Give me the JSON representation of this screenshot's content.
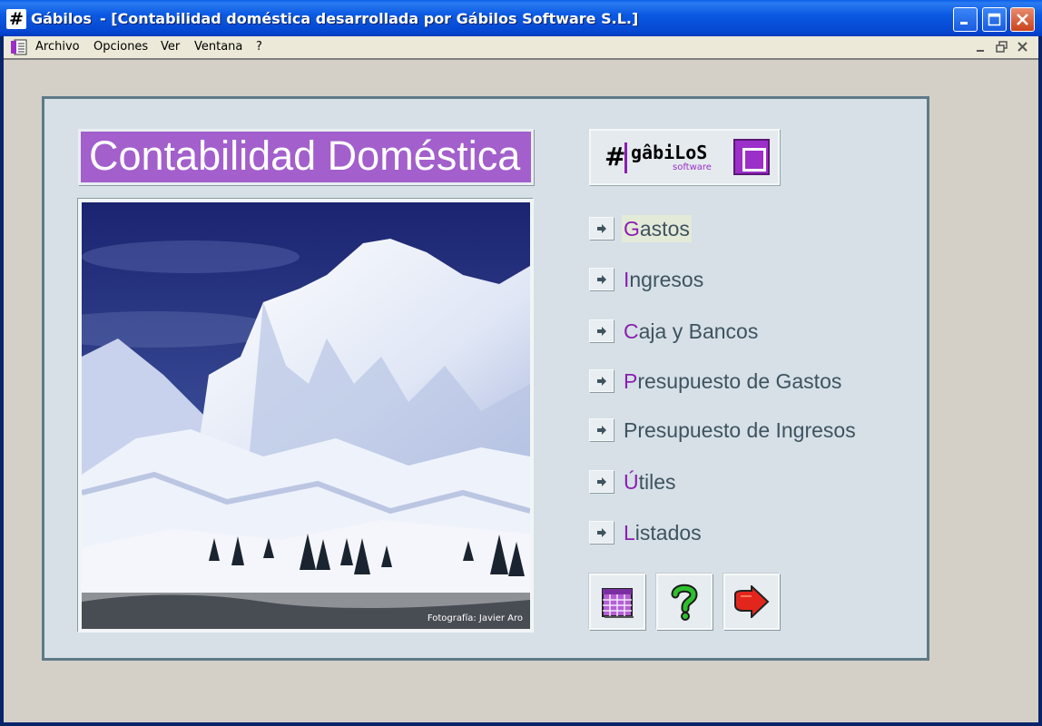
{
  "window": {
    "app_name": "Gábilos",
    "document_title": "- [Contabilidad doméstica desarrollada por Gábilos Software S.L.]",
    "app_icon_glyph": "#"
  },
  "menubar": {
    "items": [
      "Archivo",
      "Opciones",
      "Ver",
      "Ventana",
      "?"
    ]
  },
  "main": {
    "title": "Contabilidad Doméstica",
    "photo_credit": "Fotografía: Javier Aro",
    "logo": {
      "symbol": "#",
      "word": "gâbiLoS",
      "sub": "software"
    },
    "nav": [
      {
        "first": "G",
        "rest": "astos",
        "active": true
      },
      {
        "first": "I",
        "rest": "ngresos",
        "active": false
      },
      {
        "first": "C",
        "rest": "aja y Bancos",
        "active": false
      },
      {
        "first": "P",
        "rest": "resupuesto de Gastos",
        "active": false
      },
      {
        "first": "P",
        "mid_plain": "",
        "rest": "resupuesto de Ingresos",
        "active": false
      },
      {
        "first": "Ú",
        "rest": "tiles",
        "active": false
      },
      {
        "first": "L",
        "rest": "istados",
        "active": false
      }
    ],
    "tools": [
      {
        "icon": "calendar-icon"
      },
      {
        "icon": "question-mark-icon"
      },
      {
        "icon": "exit-arrow-icon"
      }
    ]
  },
  "colors": {
    "titlebar": "#0546d0",
    "title_box": "#a35fcc",
    "panel": "#d6e0e6",
    "panel_border": "#5f7a87",
    "label": "#3e5360",
    "hotkey": "#8a1fb0",
    "client": "#d4d0c8"
  }
}
